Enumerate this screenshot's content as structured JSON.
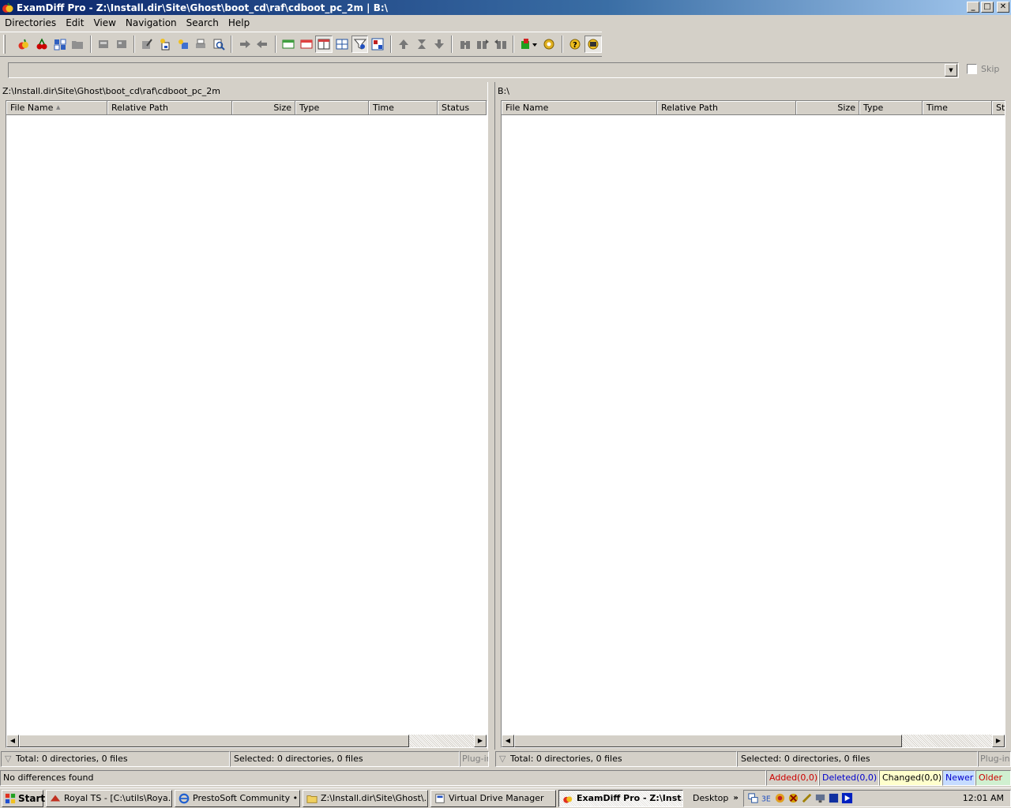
{
  "window": {
    "title": "ExamDiff Pro - Z:\\Install.dir\\Site\\Ghost\\boot_cd\\raf\\cdboot_pc_2m  |  B:\\",
    "buttons": {
      "minimize": "_",
      "maximize": "□",
      "close": "✕"
    }
  },
  "menu": [
    "Directories",
    "Edit",
    "View",
    "Navigation",
    "Search",
    "Help"
  ],
  "toolbar": {
    "icons": [
      "compare-icon",
      "cherries-icon",
      "open-dirs-icon",
      "folder-icon",
      "save-icon",
      "save-as-icon",
      "edit-icon",
      "new-file-icon",
      "copy-icon",
      "print-icon",
      "print-preview-icon",
      "arrow-right-icon",
      "arrow-left-icon",
      "window-green-icon",
      "window-red-icon",
      "split-view-icon",
      "grid-view-icon",
      "filter-icon",
      "view-toggle-icon",
      "up-icon",
      "middle-icon",
      "down-icon",
      "binoculars-icon",
      "find-next-icon",
      "find-prev-icon",
      "plugin-icon",
      "options-icon",
      "help-icon",
      "about-icon"
    ]
  },
  "combo": {
    "value": "",
    "skip_label": "Skip"
  },
  "left_pane": {
    "path": "Z:\\Install.dir\\Site\\Ghost\\boot_cd\\raf\\cdboot_pc_2m",
    "columns": [
      "File Name",
      "Relative Path",
      "Size",
      "Type",
      "Time",
      "Status"
    ],
    "status_total": "Total: 0 directories, 0 files",
    "status_selected": "Selected: 0 directories, 0 files",
    "plugin_label": "Plug-in"
  },
  "right_pane": {
    "path": "B:\\",
    "columns": [
      "File Name",
      "Relative Path",
      "Size",
      "Type",
      "Time",
      "St"
    ],
    "status_total": "Total: 0 directories, 0 files",
    "status_selected": "Selected: 0 directories, 0 files",
    "plugin_label": "Plug-in"
  },
  "status": {
    "message": "No differences found",
    "added": "Added(0,0)",
    "deleted": "Deleted(0,0)",
    "changed": "Changed(0,0)",
    "newer": "Newer",
    "older": "Older",
    "colors": {
      "added": "#cc0000",
      "deleted": "#0000cc",
      "changed_bg": "#ffffcc",
      "newer_bg": "#c6dcff",
      "older_bg": "#d0f0d0"
    }
  },
  "taskbar": {
    "start_label": "Start",
    "tasks": [
      "Royal TS - [C:\\utils\\Roya...",
      "PrestoSoft Community • ...",
      "Z:\\Install.dir\\Site\\Ghost\\...",
      "Virtual Drive Manager",
      "ExamDiff Pro - Z:\\Inst..."
    ],
    "desktop_label": "Desktop",
    "chevron": "»",
    "clock": "12:01 AM"
  }
}
